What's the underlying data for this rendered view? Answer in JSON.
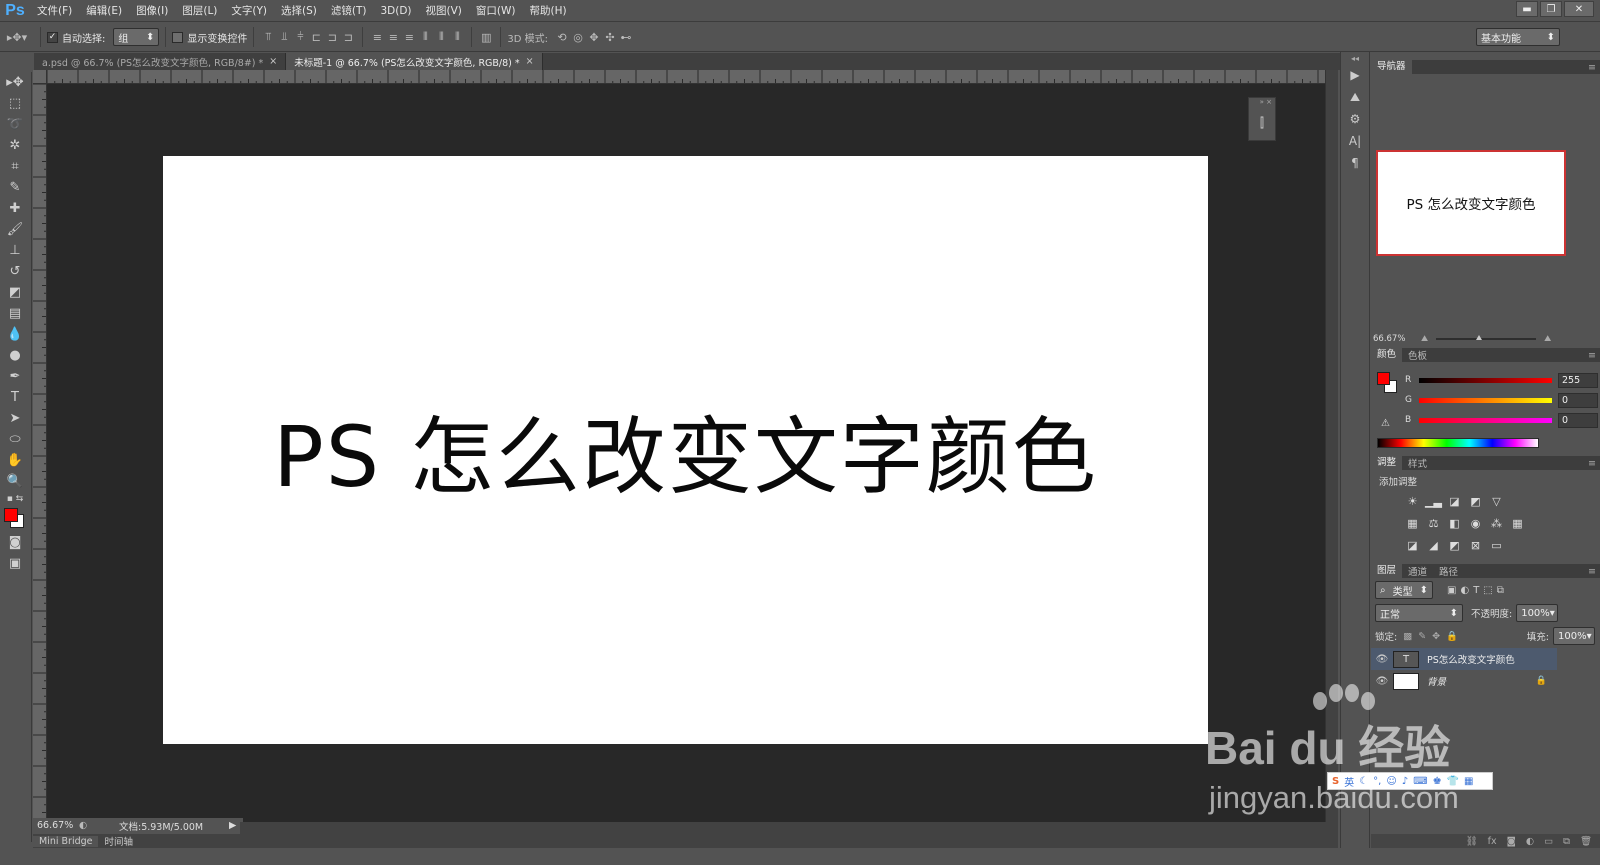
{
  "app": {
    "logo": "Ps"
  },
  "menu": [
    "文件(F)",
    "编辑(E)",
    "图像(I)",
    "图层(L)",
    "文字(Y)",
    "选择(S)",
    "滤镜(T)",
    "3D(D)",
    "视图(V)",
    "窗口(W)",
    "帮助(H)"
  ],
  "options": {
    "auto_select_label": "自动选择:",
    "auto_select_value": "组",
    "show_transform_label": "显示变换控件",
    "mode_3d_label": "3D 模式:",
    "workspace_preset": "基本功能"
  },
  "tabs": [
    {
      "label": "a.psd @ 66.7% (PS怎么改变文字颜色, RGB/8#) *",
      "active": false
    },
    {
      "label": "未标题-1 @ 66.7% (PS怎么改变文字颜色, RGB/8) *",
      "active": true
    }
  ],
  "canvas": {
    "text": "PS 怎么改变文字颜色"
  },
  "status": {
    "zoom": "66.67%",
    "doc_size": "文档:5.93M/5.00M"
  },
  "bottom_tabs": [
    "Mini Bridge",
    "时间轴"
  ],
  "navigator": {
    "title": "导航器",
    "thumb_text": "PS 怎么改变文字颜色",
    "zoom": "66.67%"
  },
  "color_panel": {
    "tabs": [
      "颜色",
      "色板"
    ],
    "r_label": "R",
    "r_value": "255",
    "g_label": "G",
    "g_value": "0",
    "b_label": "B",
    "b_value": "0",
    "foreground": "#ff0000",
    "background": "#ffffff"
  },
  "adjust_panel": {
    "tabs": [
      "调整",
      "样式"
    ],
    "add_label": "添加调整"
  },
  "layers_panel": {
    "tabs": [
      "图层",
      "通道",
      "路径"
    ],
    "filter_kind": "类型",
    "blend_mode": "正常",
    "opacity_label": "不透明度:",
    "opacity_value": "100%",
    "lock_label": "锁定:",
    "fill_label": "填充:",
    "fill_value": "100%",
    "layers": [
      {
        "name": "PS怎么改变文字颜色",
        "type": "text",
        "selected": true
      },
      {
        "name": "背景",
        "type": "background",
        "selected": false
      }
    ]
  },
  "watermark": {
    "brand": "Bai du 经验",
    "url": "jingyan.baidu.com",
    "ime": "英"
  }
}
